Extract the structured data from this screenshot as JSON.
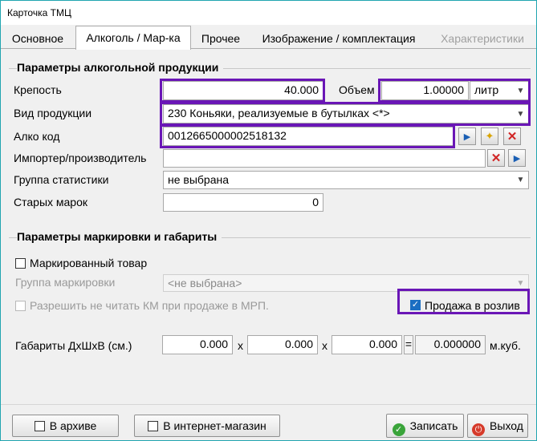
{
  "window": {
    "title": "Карточка ТМЦ"
  },
  "tabs": [
    {
      "label": "Основное",
      "active": false,
      "disabled": false
    },
    {
      "label": "Алкоголь / Мар-ка",
      "active": true,
      "disabled": false
    },
    {
      "label": "Прочее",
      "active": false,
      "disabled": false
    },
    {
      "label": "Изображение / комплектация",
      "active": false,
      "disabled": false
    },
    {
      "label": "Характеристики",
      "active": false,
      "disabled": true
    }
  ],
  "alcohol": {
    "section_title": "Параметры алкогольной продукции",
    "strength_label": "Крепость",
    "strength_value": "40.000",
    "volume_label": "Объем",
    "volume_value": "1.00000",
    "volume_unit": "литр",
    "product_type_label": "Вид продукции",
    "product_type_value": "230 Коньяки, реализуемые в бутылках <*>",
    "alcocode_label": "Алко код",
    "alcocode_value": "0012665000002518132",
    "importer_label": "Импортер/производитель",
    "importer_value": "",
    "stat_group_label": "Группа статистики",
    "stat_group_value": "не выбрана",
    "old_marks_label": "Старых марок",
    "old_marks_value": "0"
  },
  "marking": {
    "section_title": "Параметры маркировки и габариты",
    "marked_label": "Маркированный товар",
    "marked_checked": false,
    "marking_group_label": "Группа маркировки",
    "marking_group_value": "<не выбрана>",
    "allow_no_km_label": "Разрешить не читать КМ при продаже в МРП.",
    "draft_sale_label": "Продажа в розлив",
    "draft_sale_checked": true,
    "dims_label": "Габариты ДхШхВ (см.)",
    "dim_l": "0.000",
    "dim_w": "0.000",
    "dim_h": "0.000",
    "x1": "x",
    "x2": "x",
    "eq": "=",
    "volume_total": "0.000000",
    "volume_unit": "м.куб."
  },
  "footer": {
    "archive_label": "В архиве",
    "shop_label": "В интернет-магазин",
    "save_label": "Записать",
    "exit_label": "Выход"
  },
  "colors": {
    "highlight": "#6a16b6",
    "accent": "#1b6ec2",
    "close_red": "#d12424"
  }
}
